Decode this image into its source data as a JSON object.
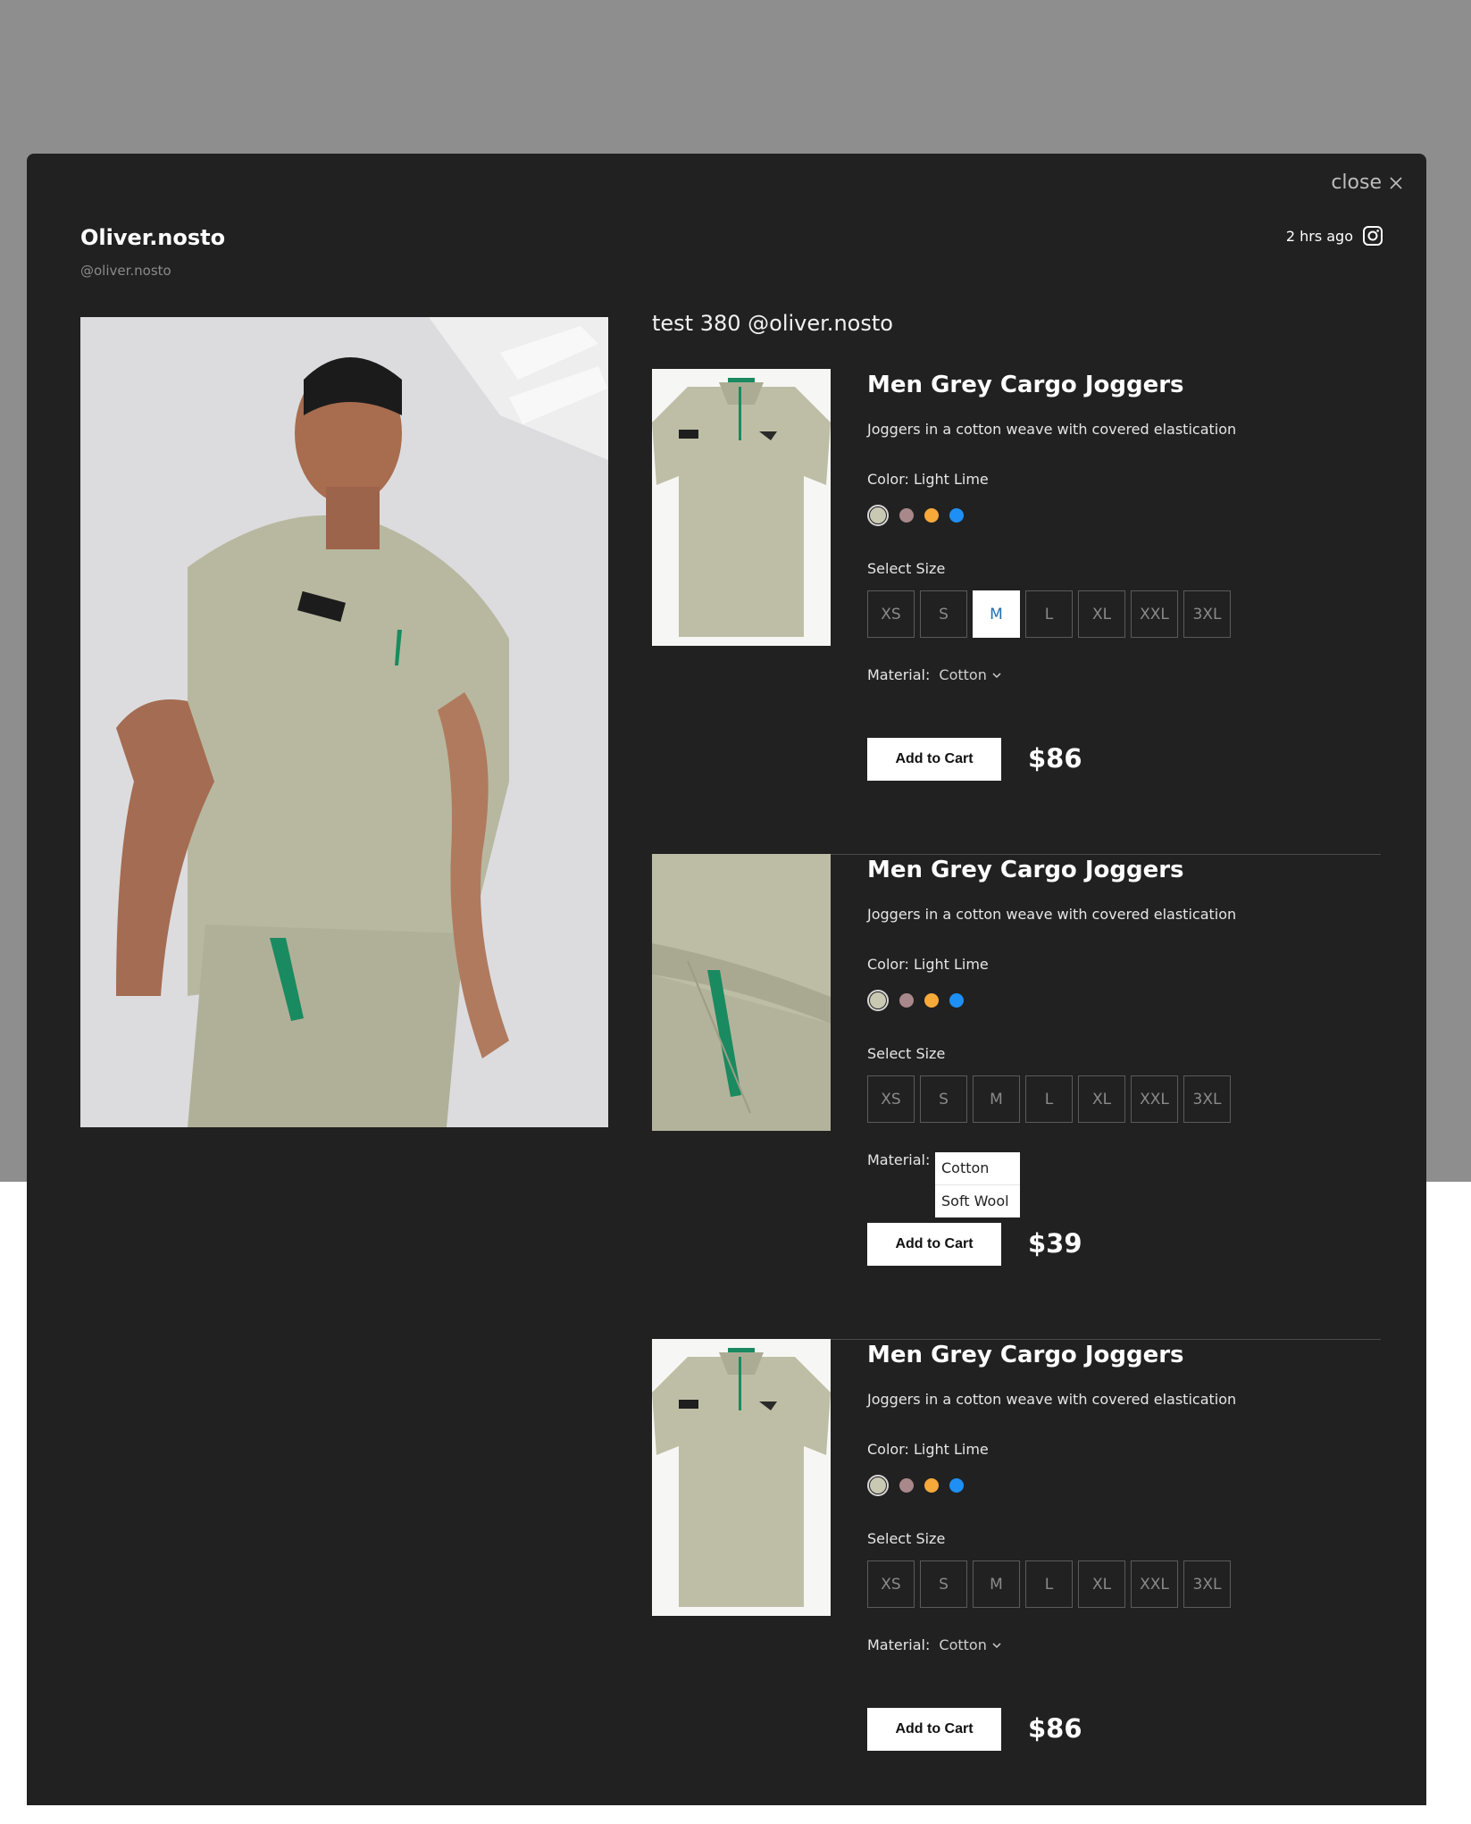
{
  "modal": {
    "close_label": "close"
  },
  "user": {
    "name": "Oliver.nosto",
    "handle": "@oliver.nosto",
    "time": "2 hrs ago"
  },
  "caption": "test 380 @oliver.nosto",
  "colors": {
    "background": "#212121",
    "backdrop": "#8e8e8e",
    "swatches": [
      "#c9c9b3",
      "#a8888a",
      "#f7a93a",
      "#1e8ff5"
    ]
  },
  "products": [
    {
      "title": "Men Grey Cargo Joggers",
      "description": "Joggers in a cotton weave with covered elastication",
      "color_label": "Color: Light Lime",
      "size_label": "Select Size",
      "sizes": [
        "XS",
        "S",
        "M",
        "L",
        "XL",
        "XXL",
        "3XL"
      ],
      "selected_size": "M",
      "material_label": "Material:",
      "material_value": "Cotton",
      "add_label": "Add to Cart",
      "price": "$86"
    },
    {
      "title": "Men Grey Cargo Joggers",
      "description": "Joggers in a cotton weave with covered elastication",
      "color_label": "Color: Light Lime",
      "size_label": "Select Size",
      "sizes": [
        "XS",
        "S",
        "M",
        "L",
        "XL",
        "XXL",
        "3XL"
      ],
      "material_label": "Material:",
      "material_options": [
        "Cotton",
        "Soft Wool"
      ],
      "add_label": "Add to Cart",
      "price": "$39"
    },
    {
      "title": "Men Grey Cargo Joggers",
      "description": "Joggers in a cotton weave with covered elastication",
      "color_label": "Color: Light Lime",
      "size_label": "Select Size",
      "sizes": [
        "XS",
        "S",
        "M",
        "L",
        "XL",
        "XXL",
        "3XL"
      ],
      "material_label": "Material:",
      "material_value": "Cotton",
      "add_label": "Add to Cart",
      "price": "$86"
    }
  ]
}
